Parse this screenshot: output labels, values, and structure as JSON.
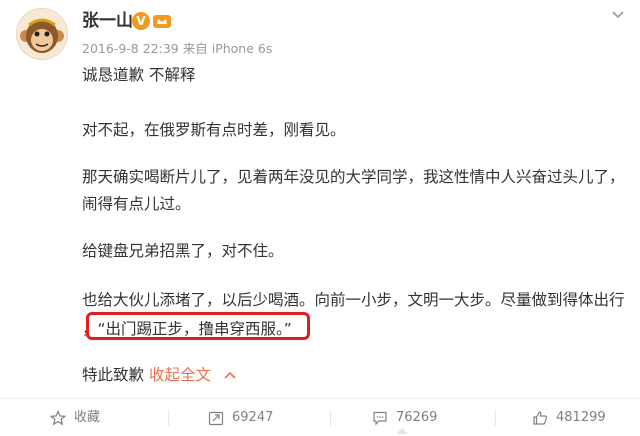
{
  "user": {
    "name": "张一山",
    "verified_mark": "V"
  },
  "meta": {
    "datetime": "2016-9-8 22:39",
    "source": "来自 iPhone 6s"
  },
  "post": {
    "line1": "诚恳道歉 不解释",
    "line2": "对不起，在俄罗斯有点时差，刚看见。",
    "line3a": "那天确实喝断片儿了，见着两年没见的大学同学，我这性情中人兴奋过头儿了，",
    "line3b": "闹得有点儿过。",
    "line4": "给键盘兄弟招黑了，对不住。",
    "line5a": "也给大伙儿添堵了，以后少喝酒。向前一小步，文明一大步。尽量做到得体出行",
    "line5b": "，“出门踢正步，撸串穿西服。”",
    "line6": "特此致歉",
    "collapse_label": "收起全文",
    "collapse_icon": "chevron-up-icon"
  },
  "actions": {
    "favorite_label": "收藏",
    "repost_count": "69247",
    "comment_count": "76269",
    "like_count": "481299"
  },
  "colors": {
    "highlight_border": "#e02020",
    "link": "#eb7350",
    "badge_orange": "#f29a1f"
  }
}
